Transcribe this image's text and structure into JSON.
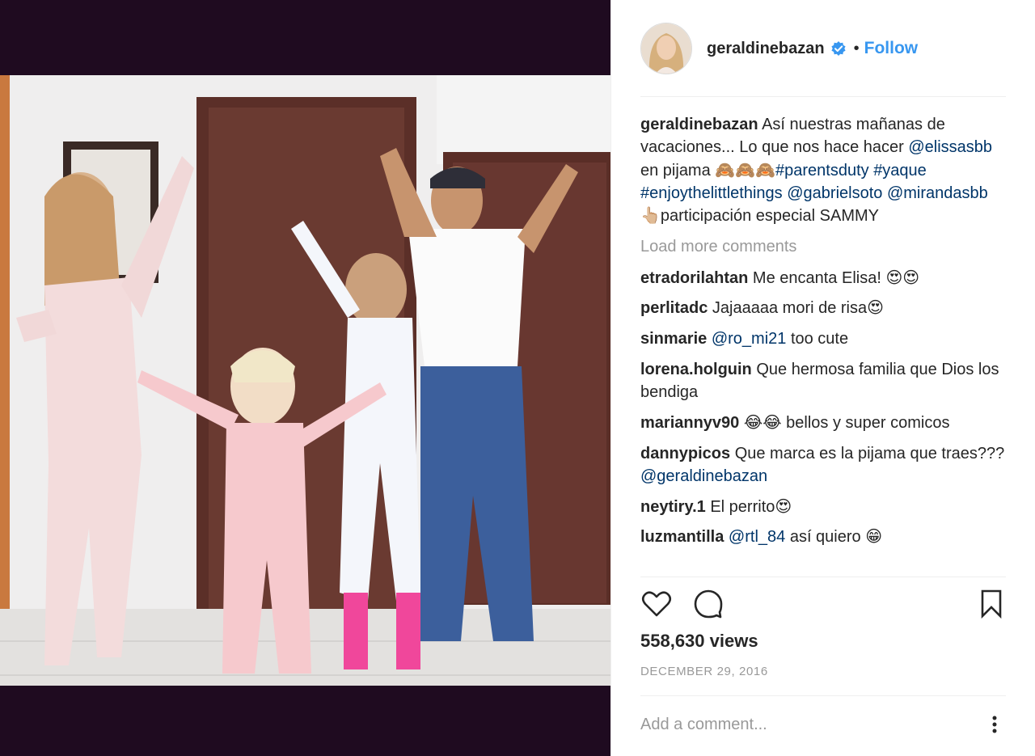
{
  "post": {
    "author": "geraldinebazan",
    "follow_label": "Follow",
    "separator": "•",
    "caption": {
      "user": "geraldinebazan",
      "text_1": " Así nuestras mañanas de vacaciones... Lo que nos hace hacer ",
      "mention_1": "@elissasbb",
      "text_2": " en pijama 🙈🙈🙈",
      "hashtag_1": "#parentsduty",
      "text_3": " ",
      "hashtag_2": "#yaque",
      "text_4": " ",
      "hashtag_3": "#enjoythelittlethings",
      "text_5": " ",
      "mention_2": "@gabrielsoto",
      "text_6": " ",
      "mention_3": "@mirandasbb",
      "text_7": " 👆🏼participación especial SAMMY"
    },
    "load_more_label": "Load more comments",
    "comments": [
      {
        "user": "etradorilahtan",
        "pre": " Me encanta Elisa! 😍😍",
        "mention": "",
        "post": ""
      },
      {
        "user": "perlitadc",
        "pre": " Jajaaaaa mori de risa😍",
        "mention": "",
        "post": ""
      },
      {
        "user": "sinmarie",
        "pre": " ",
        "mention": "@ro_mi21",
        "post": " too cute"
      },
      {
        "user": "lorena.holguin",
        "pre": " Que hermosa familia que Dios los bendiga",
        "mention": "",
        "post": ""
      },
      {
        "user": "mariannyv90",
        "pre": " 😂😂 bellos y super comicos",
        "mention": "",
        "post": ""
      },
      {
        "user": "dannypicos",
        "pre": " Que marca es la pijama que traes??? ",
        "mention": "@geraldinebazan",
        "post": ""
      },
      {
        "user": "neytiry.1",
        "pre": " El perrito😍",
        "mention": "",
        "post": ""
      },
      {
        "user": "luzmantilla",
        "pre": " ",
        "mention": "@rtl_84",
        "post": " así quiero 😁"
      }
    ],
    "views": "558,630 views",
    "date": "DECEMBER 29, 2016",
    "add_comment_placeholder": "Add a comment..."
  },
  "icons": {
    "verified": "verified-badge-icon",
    "like": "heart-icon",
    "comment": "comment-bubble-icon",
    "save": "bookmark-icon",
    "more": "more-dots-icon"
  },
  "colors": {
    "link": "#003569",
    "follow": "#3897f0",
    "muted": "#999999",
    "media_background": "#1f0b20"
  }
}
